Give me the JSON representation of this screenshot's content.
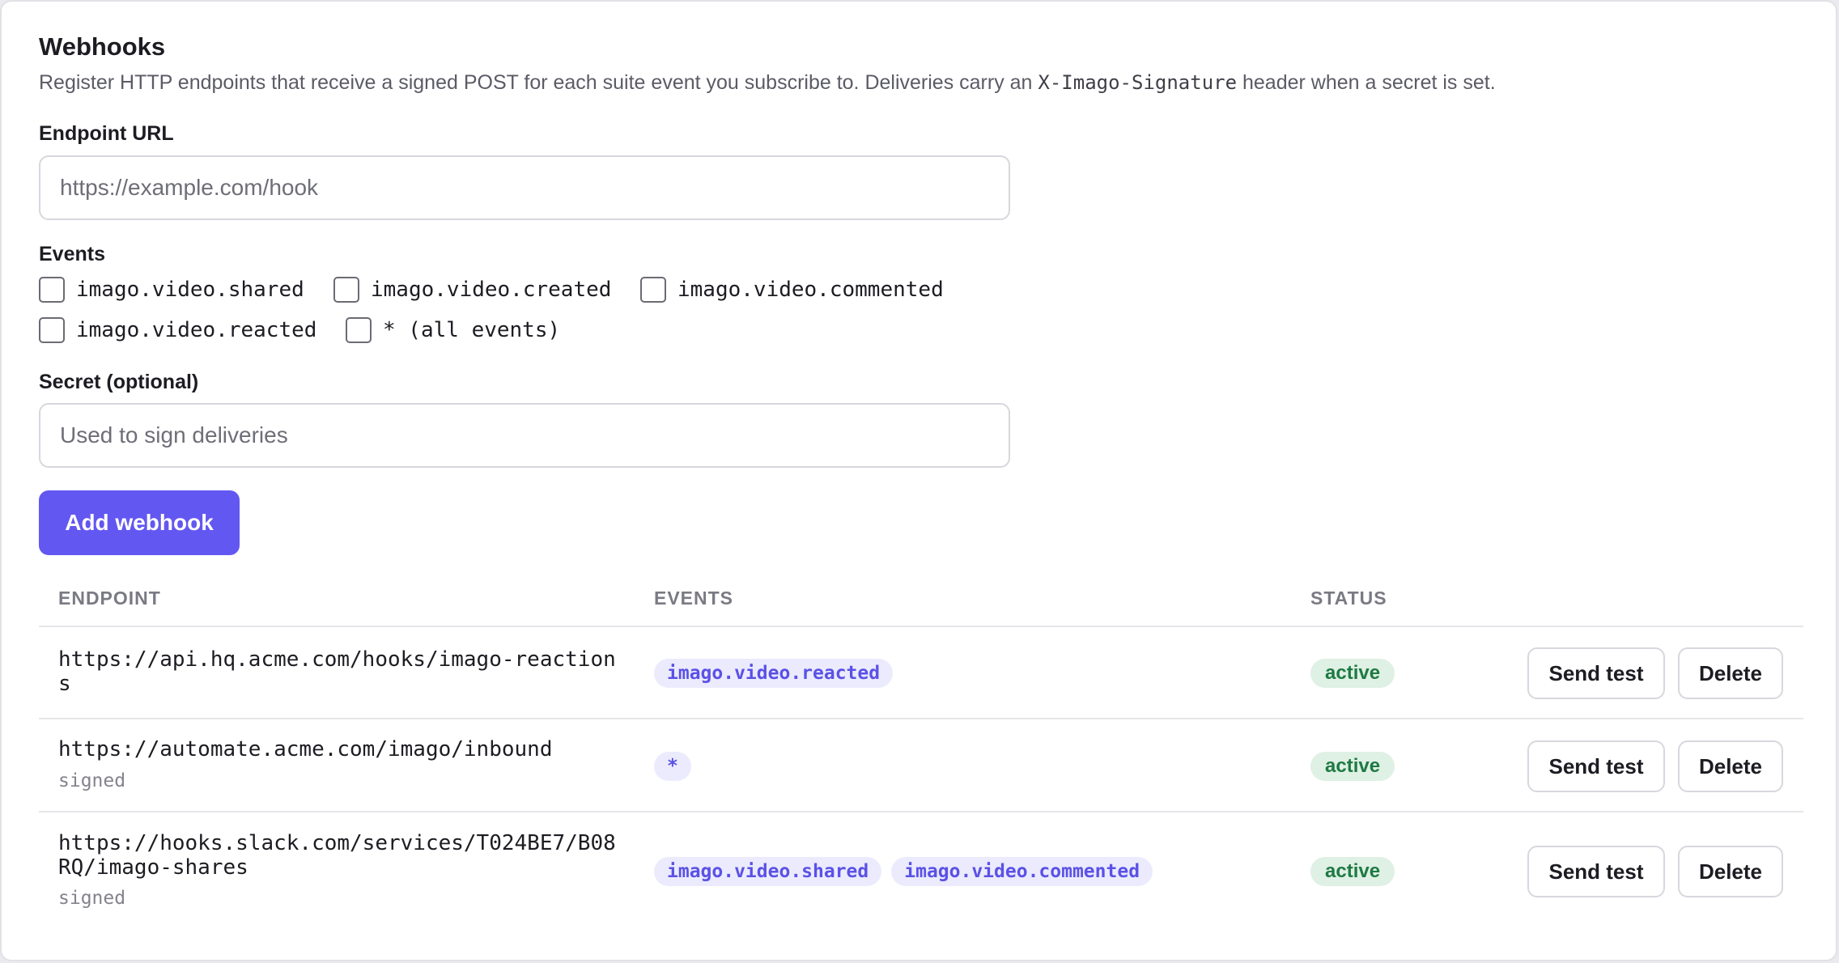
{
  "header": {
    "title": "Webhooks",
    "description_before": "Register HTTP endpoints that receive a signed POST for each suite event you subscribe to. Deliveries carry an ",
    "description_code": "X-Imago-Signature",
    "description_after": " header when a secret is set."
  },
  "form": {
    "endpoint_label": "Endpoint URL",
    "endpoint_placeholder": "https://example.com/hook",
    "endpoint_value": "",
    "events_label": "Events",
    "events": [
      {
        "label": "imago.video.shared",
        "checked": false
      },
      {
        "label": "imago.video.created",
        "checked": false
      },
      {
        "label": "imago.video.commented",
        "checked": false
      },
      {
        "label": "imago.video.reacted",
        "checked": false
      },
      {
        "label": "* (all events)",
        "checked": false
      }
    ],
    "secret_label": "Secret (optional)",
    "secret_placeholder": "Used to sign deliveries",
    "secret_value": "",
    "submit_label": "Add webhook"
  },
  "table": {
    "columns": [
      "ENDPOINT",
      "EVENTS",
      "STATUS"
    ],
    "rows": [
      {
        "endpoint": "https://api.hq.acme.com/hooks/imago-reactions",
        "signed": "",
        "events": [
          "imago.video.reacted"
        ],
        "status": "active",
        "send_test_label": "Send test",
        "delete_label": "Delete"
      },
      {
        "endpoint": "https://automate.acme.com/imago/inbound",
        "signed": "signed",
        "events": [
          "*"
        ],
        "status": "active",
        "send_test_label": "Send test",
        "delete_label": "Delete"
      },
      {
        "endpoint": "https://hooks.slack.com/services/T024BE7/B08RQ/imago-shares",
        "signed": "signed",
        "events": [
          "imago.video.shared",
          "imago.video.commented"
        ],
        "status": "active",
        "send_test_label": "Send test",
        "delete_label": "Delete"
      }
    ]
  },
  "colors": {
    "accent": "#6357f2",
    "chip_background": "#ebebfd",
    "chip_text": "#5b51e6",
    "status_background": "#dff0e4",
    "status_text": "#1e7a43"
  }
}
